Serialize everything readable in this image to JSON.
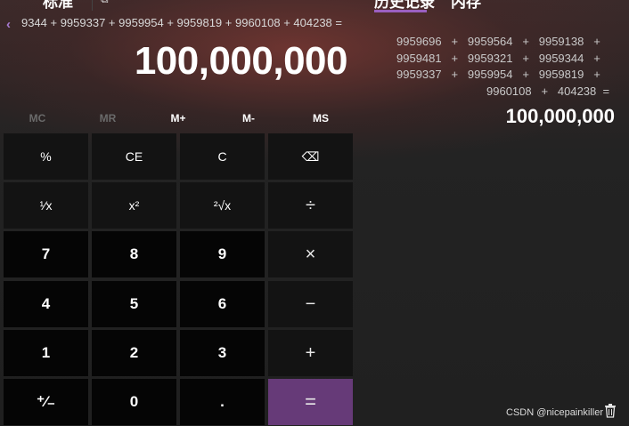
{
  "header": {
    "mode_title": "标准",
    "mode_icon": "keep-on-top-icon",
    "tabs": [
      {
        "label": "历史记录"
      },
      {
        "label": "内存"
      }
    ]
  },
  "expression": {
    "text": "9344 + 9959337 + 9959954 + 9959819 + 9960108 + 404238 =",
    "back_icon": "chevron-left-icon"
  },
  "display": {
    "value": "100,000,000"
  },
  "memory": [
    {
      "label": "MC",
      "enabled": false
    },
    {
      "label": "MR",
      "enabled": false
    },
    {
      "label": "M+",
      "enabled": true
    },
    {
      "label": "M-",
      "enabled": true
    },
    {
      "label": "MS",
      "enabled": true
    }
  ],
  "keys": [
    {
      "label": "%",
      "kind": "fn",
      "name": "percent-button"
    },
    {
      "label": "CE",
      "kind": "fn",
      "name": "clear-entry-button"
    },
    {
      "label": "C",
      "kind": "fn",
      "name": "clear-button"
    },
    {
      "label": "⌫",
      "kind": "fn",
      "name": "backspace-button"
    },
    {
      "label": "¹⁄x",
      "kind": "fn",
      "name": "reciprocal-button"
    },
    {
      "label": "x²",
      "kind": "fn",
      "name": "square-button"
    },
    {
      "label": "²√x",
      "kind": "fn",
      "name": "square-root-button"
    },
    {
      "label": "÷",
      "kind": "op",
      "name": "divide-button"
    },
    {
      "label": "7",
      "kind": "num",
      "name": "digit-7-button"
    },
    {
      "label": "8",
      "kind": "num",
      "name": "digit-8-button"
    },
    {
      "label": "9",
      "kind": "num",
      "name": "digit-9-button"
    },
    {
      "label": "×",
      "kind": "op",
      "name": "multiply-button"
    },
    {
      "label": "4",
      "kind": "num",
      "name": "digit-4-button"
    },
    {
      "label": "5",
      "kind": "num",
      "name": "digit-5-button"
    },
    {
      "label": "6",
      "kind": "num",
      "name": "digit-6-button"
    },
    {
      "label": "−",
      "kind": "op",
      "name": "subtract-button"
    },
    {
      "label": "1",
      "kind": "num",
      "name": "digit-1-button"
    },
    {
      "label": "2",
      "kind": "num",
      "name": "digit-2-button"
    },
    {
      "label": "3",
      "kind": "num",
      "name": "digit-3-button"
    },
    {
      "label": "+",
      "kind": "op",
      "name": "add-button"
    },
    {
      "label": "⁺⁄₋",
      "kind": "num",
      "name": "negate-button"
    },
    {
      "label": "0",
      "kind": "num",
      "name": "digit-0-button"
    },
    {
      "label": ".",
      "kind": "num",
      "name": "decimal-button"
    },
    {
      "label": "=",
      "kind": "eq",
      "name": "equals-button"
    }
  ],
  "history": {
    "lines": [
      "9959696   +   9959564   +   9959138   +",
      "9959481   +   9959321   +   9959344   +",
      "9959337   +   9959954   +   9959819   +",
      "9960108   +   404238  ="
    ],
    "result": "100,000,000"
  },
  "footer": {
    "watermark": "CSDN @nicepainkiller",
    "trash_icon": "trash-icon"
  },
  "colors": {
    "accent": "#9a5fc0",
    "equals_key": "#663a78",
    "number_key": "#050505",
    "function_key": "#131313"
  }
}
